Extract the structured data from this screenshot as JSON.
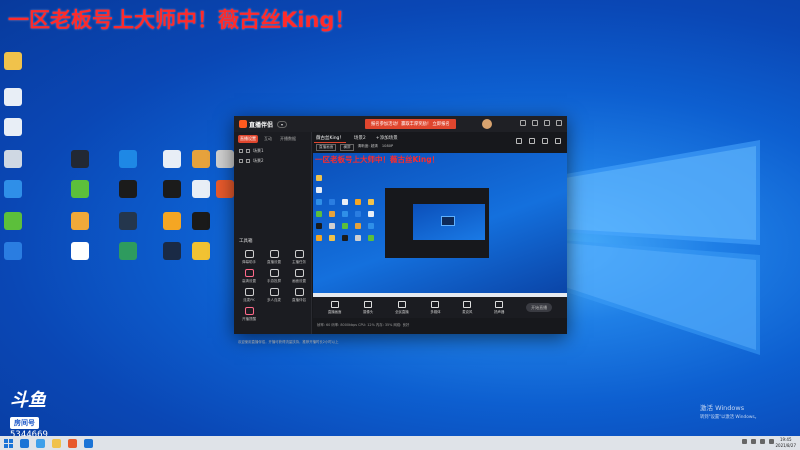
{
  "overlay": {
    "title": "一区老板号上大师中！薇古丝King！"
  },
  "desktop": {
    "icons": [
      {
        "label": "",
        "color": "#f0c24b"
      },
      {
        "label": "",
        "color": "#e8eef6"
      },
      {
        "label": "",
        "color": "#e8eef6"
      },
      {
        "label": "",
        "color": "#cfd8e3"
      },
      {
        "label": "",
        "color": "#2f8fe8"
      },
      {
        "label": "",
        "color": "#5cbf3b"
      },
      {
        "label": "",
        "color": "#2a7de1"
      },
      {
        "label": "",
        "color": "#222833"
      },
      {
        "label": "",
        "color": "#5cbf3b"
      },
      {
        "label": "",
        "color": "#f1a93a"
      },
      {
        "label": "",
        "color": "#ffffff"
      },
      {
        "label": "",
        "color": "#1e88e5"
      },
      {
        "label": "",
        "color": "#1b1b1b"
      },
      {
        "label": "",
        "color": "#24364d"
      },
      {
        "label": "",
        "color": "#2e9b5e"
      },
      {
        "label": "",
        "color": "#e8eef6"
      },
      {
        "label": "",
        "color": "#1b1b1b"
      },
      {
        "label": "",
        "color": "#f5a623"
      },
      {
        "label": "",
        "color": "#1a2a45"
      },
      {
        "label": "",
        "color": "#e6a23c"
      },
      {
        "label": "",
        "color": "#e8eef6"
      },
      {
        "label": "",
        "color": "#1a1a1a"
      },
      {
        "label": "",
        "color": "#f1c232"
      },
      {
        "label": "",
        "color": "#d0d0d0"
      },
      {
        "label": "",
        "color": "#e85a2c"
      }
    ]
  },
  "app": {
    "name": "直播伴侣",
    "promo": "报名参加活动！赢取丰厚奖励！ 立即报名",
    "left_tabs": [
      "直播设置",
      "互动",
      "开播数据"
    ],
    "scenes": [
      "场景1",
      "场景2"
    ],
    "tools_title": "工具箱",
    "tools": [
      "弹幕助手",
      "直播设置",
      "主播任务",
      "高清设置",
      "手游投屏",
      "画面设置",
      "连麦PK",
      "多人连麦",
      "直播伴侣",
      "开播提醒"
    ],
    "left_footer": "欢迎使用直播伴侣，开播可获得流量扶持，推荐开播时长2小时以上",
    "top_tabs": [
      "薇古丝King！",
      "场景2",
      "+添加场景"
    ],
    "subbar": [
      "直播画面",
      "横屏",
      "清晰度: 超清",
      "1080P"
    ],
    "preview_title": "一区老板号上大师中！薇古丝King！",
    "bottom_buttons": [
      "直播画面",
      "摄像头",
      "全民直播",
      "多媒体",
      "麦克风",
      "扬声器"
    ],
    "go_live": "开始直播",
    "status": "帧率: 60  码率: 8000kbps  CPU: 12%  内存: 35%  网络: 良好"
  },
  "stream": {
    "logo": "斗鱼",
    "tag": "房间号",
    "room_number": "5344669"
  },
  "activation": {
    "line1": "激活 Windows",
    "line2": "转到\"设置\"以激活 Windows。"
  },
  "taskbar": {
    "apps": [
      {
        "color": "#1b74d6"
      },
      {
        "color": "#3da0ea"
      },
      {
        "color": "#f0c24b"
      },
      {
        "color": "#e85a2c"
      },
      {
        "color": "#1b74d6"
      }
    ],
    "time": "19:45",
    "date": "2021/8/27"
  }
}
